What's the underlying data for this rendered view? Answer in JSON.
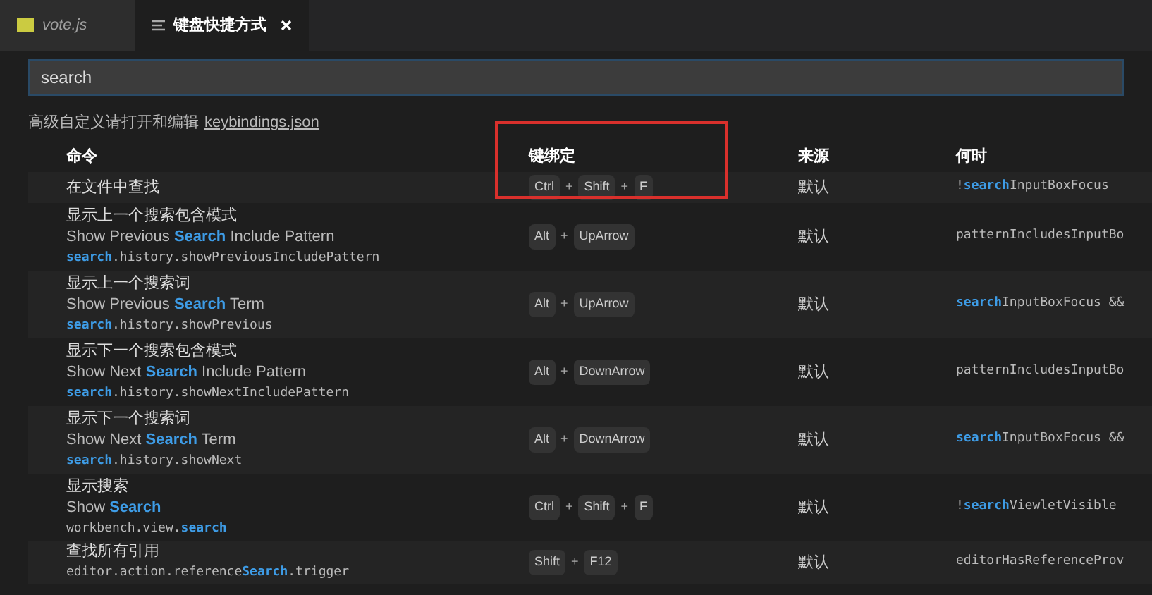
{
  "tabs": [
    {
      "kind": "js",
      "label": "vote.js",
      "selected": false,
      "closable": false
    },
    {
      "kind": "doc",
      "label": "键盘快捷方式",
      "selected": true,
      "closable": true
    }
  ],
  "search": {
    "value": "search"
  },
  "hint": {
    "text": "高级自定义请打开和编辑",
    "link": "keybindings.json"
  },
  "table": {
    "columns": [
      "命令",
      "键绑定",
      "来源",
      "何时"
    ],
    "rows": [
      {
        "label": "在文件中查找",
        "keys": [
          {
            "kind": "key",
            "text": "Ctrl"
          },
          {
            "kind": "plus",
            "text": "+"
          },
          {
            "kind": "key",
            "text": "Shift"
          },
          {
            "kind": "plus",
            "text": "+"
          },
          {
            "kind": "key",
            "text": "F"
          }
        ],
        "source": "默认",
        "when": [
          {
            "text": "!",
            "match": false
          },
          {
            "text": "search",
            "match": true
          },
          {
            "text": "InputBoxFocus",
            "match": false
          }
        ]
      },
      {
        "label": "显示上一个搜索包含模式",
        "title": [
          {
            "text": "Show Previous ",
            "match": false
          },
          {
            "text": "Search",
            "match": true
          },
          {
            "text": " Include Pattern",
            "match": false
          }
        ],
        "id": [
          {
            "text": "search",
            "match": true
          },
          {
            "text": ".history.showPreviousIncludePattern",
            "match": false
          }
        ],
        "keys": [
          {
            "kind": "key",
            "text": "Alt"
          },
          {
            "kind": "plus",
            "text": "+"
          },
          {
            "kind": "key",
            "text": "UpArrow"
          }
        ],
        "source": "默认",
        "when": [
          {
            "text": "patternIncludesInputBo",
            "match": false
          }
        ]
      },
      {
        "label": "显示上一个搜索词",
        "title": [
          {
            "text": "Show Previous ",
            "match": false
          },
          {
            "text": "Search",
            "match": true
          },
          {
            "text": " Term",
            "match": false
          }
        ],
        "id": [
          {
            "text": "search",
            "match": true
          },
          {
            "text": ".history.showPrevious",
            "match": false
          }
        ],
        "keys": [
          {
            "kind": "key",
            "text": "Alt"
          },
          {
            "kind": "plus",
            "text": "+"
          },
          {
            "kind": "key",
            "text": "UpArrow"
          }
        ],
        "source": "默认",
        "when": [
          {
            "text": "search",
            "match": true
          },
          {
            "text": "InputBoxFocus &&",
            "match": false
          }
        ]
      },
      {
        "label": "显示下一个搜索包含模式",
        "title": [
          {
            "text": "Show Next ",
            "match": false
          },
          {
            "text": "Search",
            "match": true
          },
          {
            "text": " Include Pattern",
            "match": false
          }
        ],
        "id": [
          {
            "text": "search",
            "match": true
          },
          {
            "text": ".history.showNextIncludePattern",
            "match": false
          }
        ],
        "keys": [
          {
            "kind": "key",
            "text": "Alt"
          },
          {
            "kind": "plus",
            "text": "+"
          },
          {
            "kind": "key",
            "text": "DownArrow"
          }
        ],
        "source": "默认",
        "when": [
          {
            "text": "patternIncludesInputBo",
            "match": false
          }
        ]
      },
      {
        "label": "显示下一个搜索词",
        "title": [
          {
            "text": "Show Next ",
            "match": false
          },
          {
            "text": "Search",
            "match": true
          },
          {
            "text": " Term",
            "match": false
          }
        ],
        "id": [
          {
            "text": "search",
            "match": true
          },
          {
            "text": ".history.showNext",
            "match": false
          }
        ],
        "keys": [
          {
            "kind": "key",
            "text": "Alt"
          },
          {
            "kind": "plus",
            "text": "+"
          },
          {
            "kind": "key",
            "text": "DownArrow"
          }
        ],
        "source": "默认",
        "when": [
          {
            "text": "search",
            "match": true
          },
          {
            "text": "InputBoxFocus &&",
            "match": false
          }
        ]
      },
      {
        "label": "显示搜索",
        "title": [
          {
            "text": "Show ",
            "match": false
          },
          {
            "text": "Search",
            "match": true
          }
        ],
        "id": [
          {
            "text": "workbench.view.",
            "match": false
          },
          {
            "text": "search",
            "match": true
          }
        ],
        "keys": [
          {
            "kind": "key",
            "text": "Ctrl"
          },
          {
            "kind": "plus",
            "text": "+"
          },
          {
            "kind": "key",
            "text": "Shift"
          },
          {
            "kind": "plus",
            "text": "+"
          },
          {
            "kind": "key",
            "text": "F"
          }
        ],
        "source": "默认",
        "when": [
          {
            "text": "!",
            "match": false
          },
          {
            "text": "search",
            "match": true
          },
          {
            "text": "ViewletVisible",
            "match": false
          }
        ]
      },
      {
        "label": "查找所有引用",
        "id": [
          {
            "text": "editor.action.reference",
            "match": false
          },
          {
            "text": "Search",
            "match": true
          },
          {
            "text": ".trigger",
            "match": false
          }
        ],
        "keys": [
          {
            "kind": "key",
            "text": "Shift"
          },
          {
            "kind": "plus",
            "text": "+"
          },
          {
            "kind": "key",
            "text": "F12"
          }
        ],
        "source": "默认",
        "when": [
          {
            "text": "editorHasReferenceProv",
            "match": false
          }
        ]
      }
    ]
  }
}
